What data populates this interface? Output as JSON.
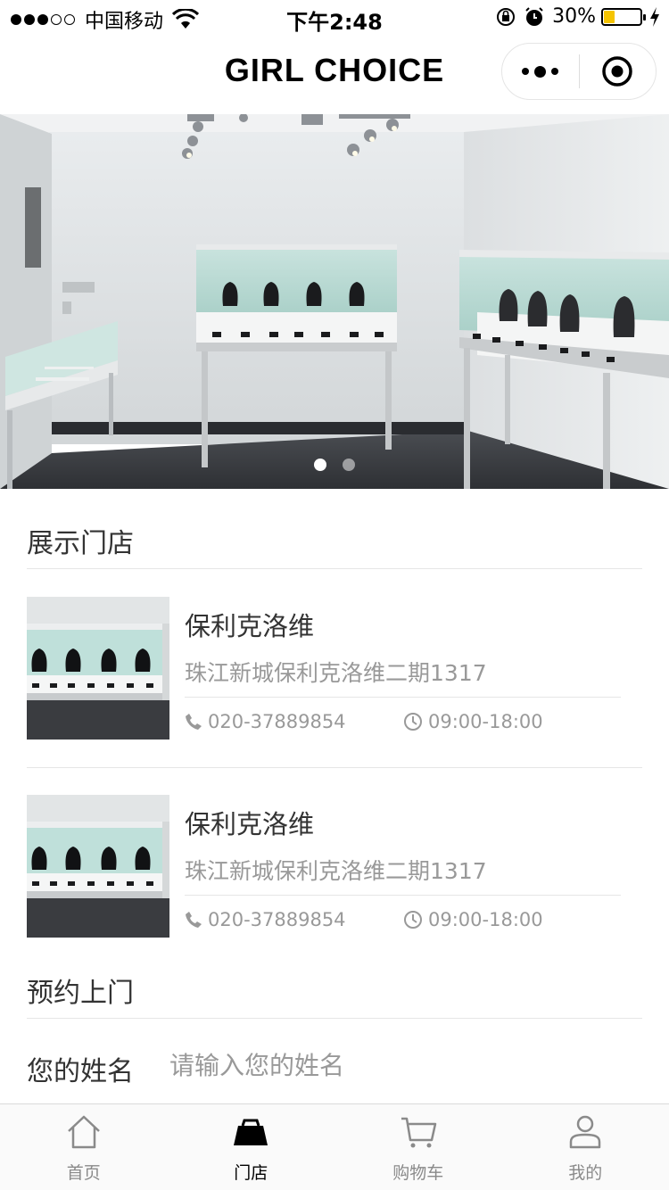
{
  "status_bar": {
    "carrier": "中国移动",
    "time": "下午2:48",
    "battery": "30%",
    "battery_level": 0.3,
    "battery_color": "#f5c400"
  },
  "nav": {
    "title": "GIRL CHOICE",
    "more_icon": "more-dots-icon",
    "close_icon": "target-close-icon"
  },
  "banner": {
    "slide_count": 2,
    "active_slide": 1
  },
  "stores_section": {
    "title": "展示门店",
    "stores": [
      {
        "name": "保利克洛维",
        "address": "珠江新城保利克洛维二期1317",
        "phone": "020-37889854",
        "hours": "09:00-18:00"
      },
      {
        "name": "保利克洛维",
        "address": "珠江新城保利克洛维二期1317",
        "phone": "020-37889854",
        "hours": "09:00-18:00"
      }
    ]
  },
  "booking_section": {
    "title": "预约上门",
    "name_label": "您的姓名",
    "name_placeholder": "请输入您的姓名",
    "name_value": ""
  },
  "tab_bar": {
    "tabs": [
      {
        "label": "首页",
        "icon": "home-icon",
        "active": false
      },
      {
        "label": "门店",
        "icon": "store-icon",
        "active": true
      },
      {
        "label": "购物车",
        "icon": "cart-icon",
        "active": false
      },
      {
        "label": "我的",
        "icon": "user-icon",
        "active": false
      }
    ],
    "active_color": "#000000",
    "inactive_color": "#8a8a8a"
  }
}
